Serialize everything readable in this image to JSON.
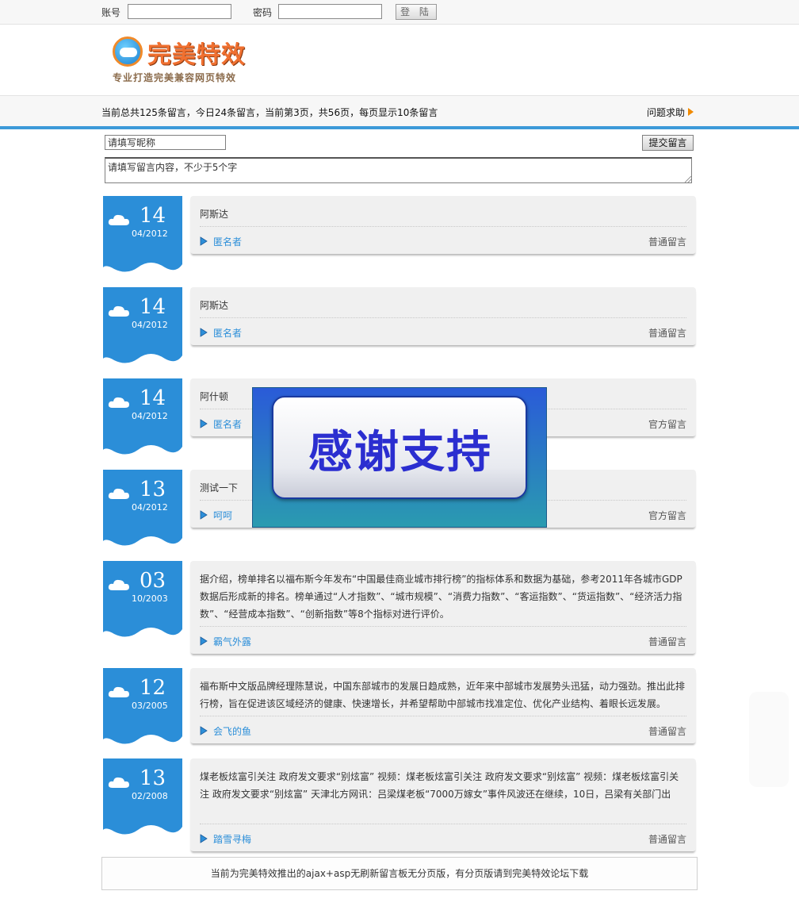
{
  "login": {
    "account_label": "账号",
    "password_label": "密码",
    "account_value": "",
    "password_value": "",
    "login_button": "登 陆"
  },
  "logo": {
    "title": "完美特效",
    "subtitle": "专业打造完美兼容网页特效"
  },
  "info": {
    "stats": "当前总共125条留言，今日24条留言，当前第3页，共56页，每页显示10条留言",
    "help": "问题求助"
  },
  "form": {
    "nickname_value": "请填写昵称",
    "content_value": "请填写留言内容，不少于5个字",
    "submit": "提交留言"
  },
  "messages": [
    {
      "day": "14",
      "ym": "04/2012",
      "text": "阿斯达",
      "author": "匿名者",
      "type": "普通留言"
    },
    {
      "day": "14",
      "ym": "04/2012",
      "text": "阿斯达",
      "author": "匿名者",
      "type": "普通留言"
    },
    {
      "day": "14",
      "ym": "04/2012",
      "text": "阿什顿",
      "author": "匿名者",
      "type": "官方留言"
    },
    {
      "day": "13",
      "ym": "04/2012",
      "text": "测试一下",
      "author": "呵呵",
      "type": "官方留言"
    },
    {
      "day": "03",
      "ym": "10/2003",
      "text": "据介绍，榜单排名以福布斯今年发布“中国最佳商业城市排行榜”的指标体系和数据为基础，参考2011年各城市GDP数据后形成新的排名。榜单通过“人才指数”、“城市规模”、“消费力指数”、“客运指数”、“货运指数”、“经济活力指数”、“经营成本指数”、“创新指数”等8个指标对进行评价。",
      "author": "霸气外露",
      "type": "普通留言"
    },
    {
      "day": "12",
      "ym": "03/2005",
      "text": "福布斯中文版品牌经理陈慧说，中国东部城市的发展日趋成熟，近年来中部城市发展势头迅猛，动力强劲。推出此排行榜，旨在促进该区域经济的健康、快速增长，并希望帮助中部城市找准定位、优化产业结构、着眼长远发展。",
      "author": "会飞的鱼",
      "type": "普通留言"
    },
    {
      "day": "13",
      "ym": "02/2008",
      "text": "煤老板炫富引关注 政府发文要求“别炫富” 视频：煤老板炫富引关注 政府发文要求“别炫富” 视频：煤老板炫富引关注 政府发文要求“别炫富” 天津北方网讯：吕梁煤老板“7000万嫁女”事件风波还在继续，10日，吕梁有关部门出",
      "author": "踏雪寻梅",
      "type": "普通留言"
    }
  ],
  "footer": "当前为完美特效推出的ajax+asp无刷新留言板无分页版，有分页版请到完美特效论坛下载",
  "overlay": "感谢支持",
  "colors": {
    "accent_blue": "#2b8ed8",
    "link_blue": "#2d8fd9",
    "help_arrow": "#f08a00"
  }
}
